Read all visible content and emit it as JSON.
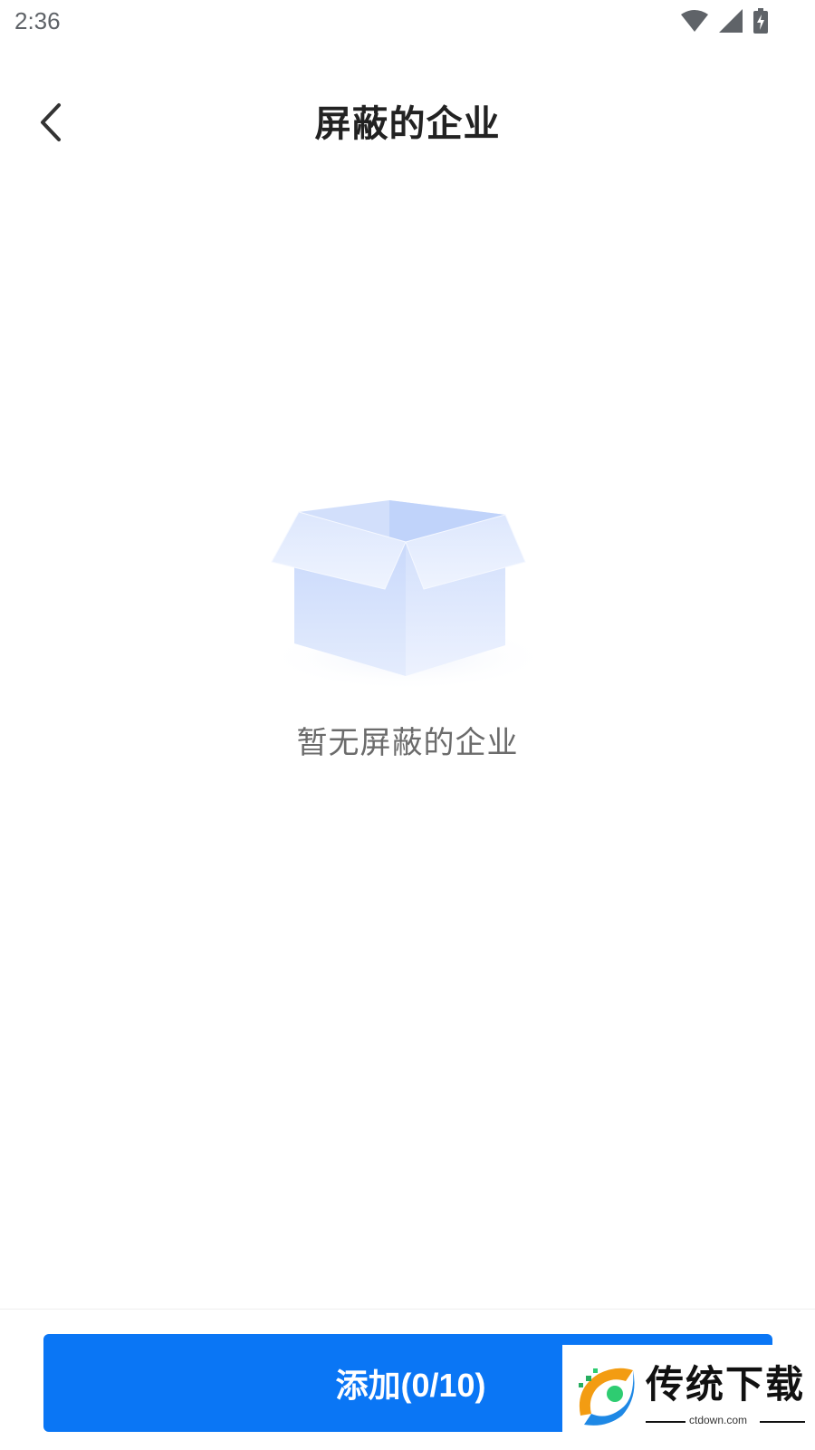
{
  "status_bar": {
    "time": "2:36",
    "icons": [
      "wifi-icon",
      "signal-icon",
      "battery-charging-icon"
    ]
  },
  "header": {
    "back_icon": "chevron-left-icon",
    "title": "屏蔽的企业"
  },
  "empty_state": {
    "illustration": "empty-box-icon",
    "message": "暂无屏蔽的企业"
  },
  "bottom": {
    "add_button_label": "添加(0/10)"
  },
  "watermark": {
    "title": "传统下载",
    "url": "ctdown.com"
  },
  "colors": {
    "accent": "#0a76f5",
    "title_text": "#222222",
    "muted_text": "#6b6b6b",
    "box_light": "#dfe9ff",
    "box_mid": "#c7d8fb"
  }
}
